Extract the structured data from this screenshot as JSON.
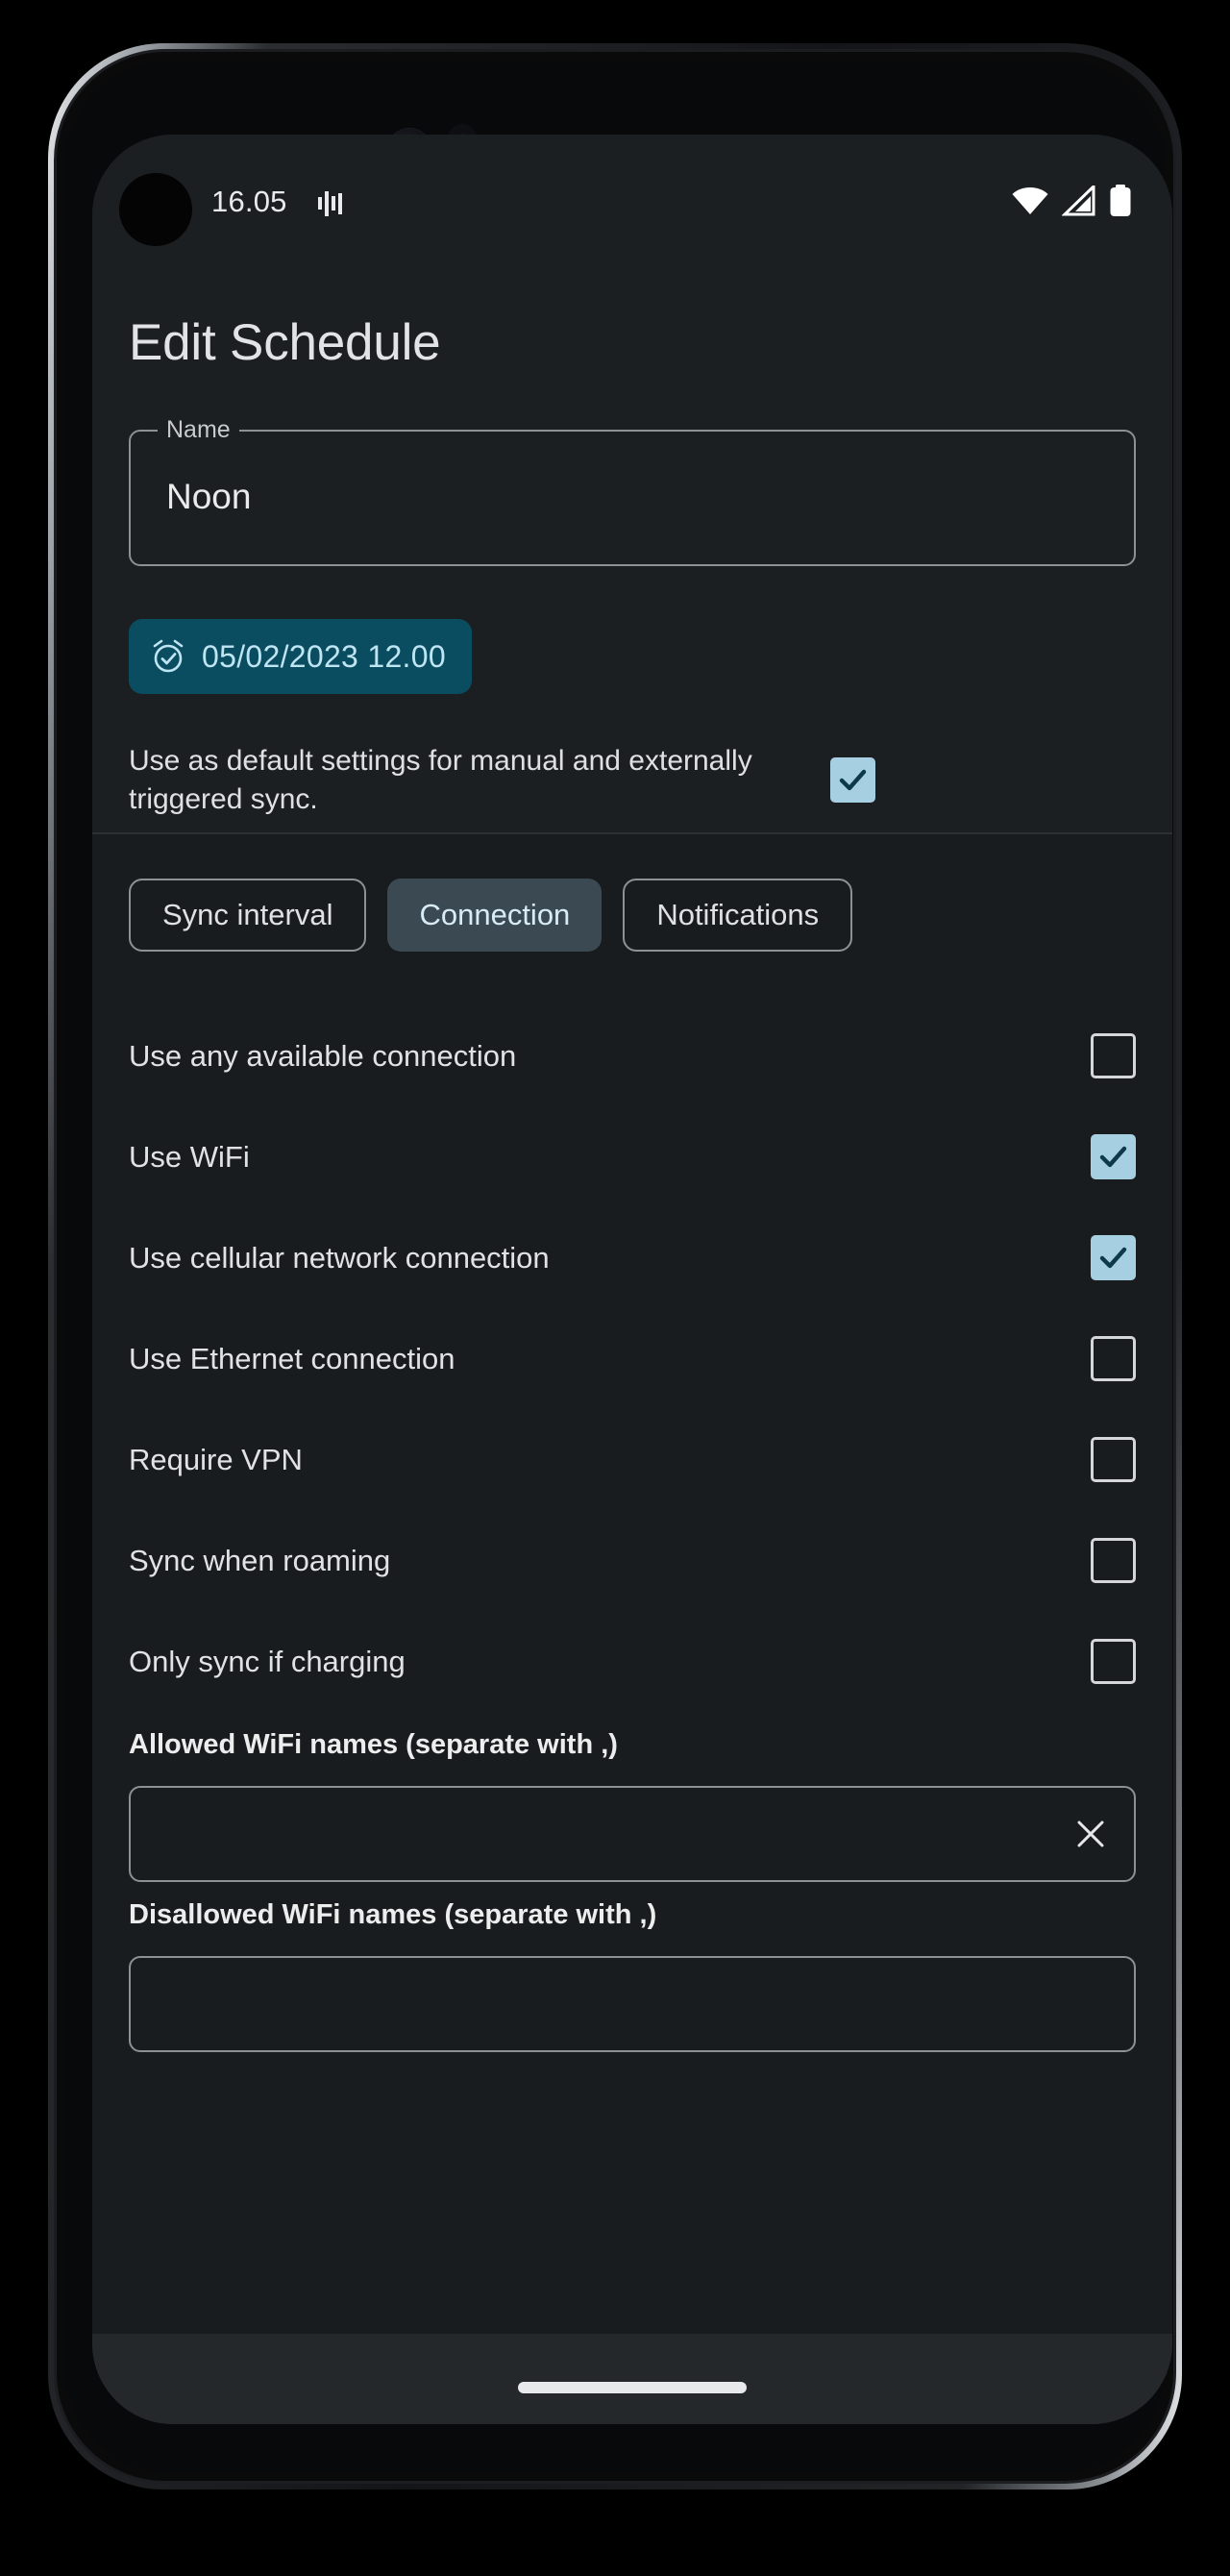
{
  "status_bar": {
    "clock": "16.05",
    "icons": [
      "vibrate-icon",
      "wifi-icon",
      "cellular-signal-icon",
      "battery-icon"
    ]
  },
  "header": {
    "title": "Edit Schedule"
  },
  "name_field": {
    "label": "Name",
    "value": "Noon",
    "placeholder": ""
  },
  "date_chip": {
    "icon": "alarm-check-icon",
    "text": "05/02/2023 12.00"
  },
  "default_settings": {
    "label": "Use as default settings for manual and externally triggered sync.",
    "checked": true
  },
  "tabs": [
    {
      "label": "Sync interval",
      "selected": false
    },
    {
      "label": "Connection",
      "selected": true
    },
    {
      "label": "Notifications",
      "selected": false
    }
  ],
  "options": [
    {
      "label": "Use any available connection",
      "checked": false
    },
    {
      "label": "Use WiFi",
      "checked": true
    },
    {
      "label": "Use cellular network connection",
      "checked": true
    },
    {
      "label": "Use Ethernet connection",
      "checked": false
    },
    {
      "label": "Require VPN",
      "checked": false
    },
    {
      "label": "Sync when roaming",
      "checked": false
    },
    {
      "label": "Only sync if charging",
      "checked": false
    }
  ],
  "allowed_wifi": {
    "heading": "Allowed WiFi names (separate with ,)",
    "value": "",
    "placeholder": "",
    "clear_icon": "close-x-icon"
  },
  "disallowed_wifi": {
    "heading": "Disallowed WiFi names (separate with ,)",
    "value": "",
    "placeholder": ""
  },
  "colors": {
    "accent_chip": "#0b4d60",
    "accent_chip_text": "#bfe4f2",
    "checkbox_on": "#a7cfe2",
    "checkbox_check": "#0d3a49",
    "tab_selected_bg": "#3b4a52",
    "surface": "#1c1f22",
    "surface_lower": "#191c1f"
  }
}
